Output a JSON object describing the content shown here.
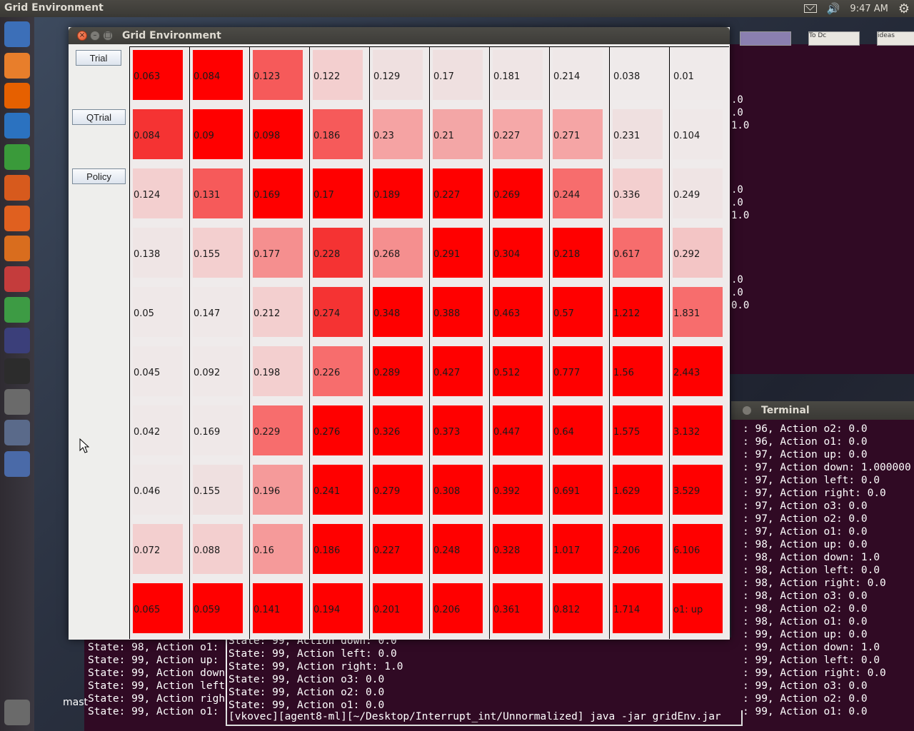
{
  "top_panel": {
    "app_title": "Grid Environment",
    "clock": "9:47 AM"
  },
  "launcher": {
    "items": [
      {
        "name": "dash-icon",
        "color": "#3c6fb8"
      },
      {
        "name": "files-icon",
        "color": "#e87e2b"
      },
      {
        "name": "firefox-icon",
        "color": "#e66000"
      },
      {
        "name": "writer-icon",
        "color": "#2b72c0"
      },
      {
        "name": "calc-icon",
        "color": "#3a9a3a"
      },
      {
        "name": "impress-icon",
        "color": "#d75a1d"
      },
      {
        "name": "software-center-icon",
        "color": "#e0601f"
      },
      {
        "name": "ubuntu-one-icon",
        "color": "#d96d1e"
      },
      {
        "name": "system-settings-icon",
        "color": "#c43c3c"
      },
      {
        "name": "chrome-icon",
        "color": "#3d9b44"
      },
      {
        "name": "eclipse-icon",
        "color": "#3b3f7a"
      },
      {
        "name": "terminal-icon",
        "color": "#2c2c2c"
      },
      {
        "name": "text-editor-icon",
        "color": "#6a6a6a"
      },
      {
        "name": "java-icon",
        "color": "#5a6a8a"
      },
      {
        "name": "workspace-switcher-icon",
        "color": "#4a6aa8"
      },
      {
        "name": "trash-icon",
        "color": "#6a6a6a"
      }
    ]
  },
  "window": {
    "title": "Grid Environment"
  },
  "buttons": {
    "trial": "Trial",
    "qtrial": "QTrial",
    "policy": "Policy"
  },
  "grid": {
    "rows": [
      [
        "0.063",
        "0.084",
        "0.123",
        "0.122",
        "0.129",
        "0.17",
        "0.181",
        "0.214",
        "0.038",
        "0.01"
      ],
      [
        "0.084",
        "0.09",
        "0.098",
        "0.186",
        "0.23",
        "0.21",
        "0.227",
        "0.271",
        "0.231",
        "0.104"
      ],
      [
        "0.124",
        "0.131",
        "0.169",
        "0.17",
        "0.189",
        "0.227",
        "0.269",
        "0.244",
        "0.336",
        "0.249"
      ],
      [
        "0.138",
        "0.155",
        "0.177",
        "0.228",
        "0.268",
        "0.291",
        "0.304",
        "0.218",
        "0.617",
        "0.292"
      ],
      [
        "0.05",
        "0.147",
        "0.212",
        "0.274",
        "0.348",
        "0.388",
        "0.463",
        "0.57",
        "1.212",
        "1.831"
      ],
      [
        "0.045",
        "0.092",
        "0.198",
        "0.226",
        "0.289",
        "0.427",
        "0.512",
        "0.777",
        "1.56",
        "2.443"
      ],
      [
        "0.042",
        "0.169",
        "0.229",
        "0.276",
        "0.326",
        "0.373",
        "0.447",
        "0.64",
        "1.575",
        "3.132"
      ],
      [
        "0.046",
        "0.155",
        "0.196",
        "0.241",
        "0.279",
        "0.308",
        "0.392",
        "0.691",
        "1.629",
        "3.529"
      ],
      [
        "0.072",
        "0.088",
        "0.16",
        "0.186",
        "0.227",
        "0.248",
        "0.328",
        "1.017",
        "2.206",
        "6.106"
      ],
      [
        "0.065",
        "0.059",
        "0.141",
        "0.194",
        "0.201",
        "0.206",
        "0.361",
        "0.812",
        "1.714",
        "o1: up"
      ]
    ],
    "colors": [
      [
        "#ff0000",
        "#ff0000",
        "#f65a5a",
        "#f3cfcf",
        "#efe0e0",
        "#efe0e0",
        "#efe5e5",
        "#efe8e8",
        "#efeaea",
        "#efeaea"
      ],
      [
        "#f53333",
        "#ff0000",
        "#ff0000",
        "#f65a5a",
        "#f5a3a3",
        "#f3a6a6",
        "#f5a8a8",
        "#f5a5a5",
        "#efe0e0",
        "#efe8e8"
      ],
      [
        "#f3cfcf",
        "#f65a5a",
        "#ff0000",
        "#ff0000",
        "#ff0000",
        "#ff0000",
        "#ff0000",
        "#f76d6d",
        "#f3cfcf",
        "#efe4e4"
      ],
      [
        "#efe5e5",
        "#f3cfcf",
        "#f58f8f",
        "#f53333",
        "#f58f8f",
        "#ff0000",
        "#ff0000",
        "#ff0000",
        "#f76d6d",
        "#f3c5c5"
      ],
      [
        "#efe8e8",
        "#efe8e8",
        "#f3cfcf",
        "#f53333",
        "#ff0000",
        "#ff0000",
        "#ff0000",
        "#ff0000",
        "#ff0000",
        "#f76d6d"
      ],
      [
        "#efe8e8",
        "#efe8e8",
        "#f3cfcf",
        "#f76d6d",
        "#ff0000",
        "#ff0000",
        "#ff0000",
        "#ff0000",
        "#ff0000",
        "#ff0000"
      ],
      [
        "#efe8e8",
        "#efe8e8",
        "#f76d6d",
        "#ff0000",
        "#ff0000",
        "#ff0000",
        "#ff0000",
        "#ff0000",
        "#ff0000",
        "#ff0000"
      ],
      [
        "#efe8e8",
        "#efe0e0",
        "#f59a9a",
        "#ff0000",
        "#ff0000",
        "#ff0000",
        "#ff0000",
        "#ff0000",
        "#ff0000",
        "#ff0000"
      ],
      [
        "#f3cfcf",
        "#f3cfcf",
        "#f59a9a",
        "#ff0000",
        "#ff0000",
        "#ff0000",
        "#ff0000",
        "#ff0000",
        "#ff0000",
        "#ff0000"
      ],
      [
        "#ff0000",
        "#ff0000",
        "#ff0000",
        "#ff0000",
        "#ff0000",
        "#ff0000",
        "#ff0000",
        "#ff0000",
        "#ff0000",
        "#ff0000"
      ]
    ]
  },
  "bg_terminal_top": {
    "values": [
      ".0",
      ".0",
      "1.0",
      ".0",
      ".0",
      "1.0",
      ".0",
      ".0",
      "0.0"
    ]
  },
  "thumbs": [
    "",
    "To Dc",
    "ideas"
  ],
  "terminal_right": {
    "title": "Terminal",
    "lines": [
      ": 96, Action o2: 0.0",
      ": 96, Action o1: 0.0",
      ": 97, Action up: 0.0",
      ": 97, Action down: 1.000000",
      ": 97, Action left: 0.0",
      ": 97, Action right: 0.0",
      ": 97, Action o3: 0.0",
      ": 97, Action o2: 0.0",
      ": 97, Action o1: 0.0",
      ": 98, Action up: 0.0",
      ": 98, Action down: 1.0",
      ": 98, Action left: 0.0",
      ": 98, Action right: 0.0",
      ": 98, Action o3: 0.0",
      ": 98, Action o2: 0.0",
      ": 98, Action o1: 0.0",
      ": 99, Action up: 0.0",
      ": 99, Action down: 1.0",
      ": 99, Action left: 0.0",
      ": 99, Action right: 0.0",
      ": 99, Action o3: 0.0",
      ": 99, Action o2: 0.0",
      ": 99, Action o1: 0.0"
    ]
  },
  "terminal_bottom_left": {
    "lines": [
      "State: 98, Action o1:",
      "State: 99, Action up:",
      "State: 99, Action down",
      "State: 99, Action left",
      "State: 99, Action righ",
      "State: 99, Action o1:"
    ]
  },
  "terminal_bottom_mid": {
    "lines": [
      "State: 99, Action down: 0.0",
      "State: 99, Action left: 0.0",
      "State: 99, Action right: 1.0",
      "State: 99, Action o3: 0.0",
      "State: 99, Action o2: 0.0",
      "State: 99, Action o1: 0.0"
    ],
    "prompt": "[vkovec][agent8-ml][~/Desktop/Interrupt_int/Unnormalized] java -jar gridEnv.jar"
  },
  "desktop_label": "mast"
}
